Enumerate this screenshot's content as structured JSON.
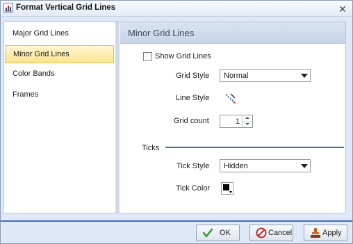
{
  "window": {
    "title": "Format Vertical Grid Lines",
    "close_glyph": "✕"
  },
  "nav": {
    "items": [
      {
        "label": "Major Grid Lines"
      },
      {
        "label": "Minor Grid Lines",
        "selected": true
      },
      {
        "label": "Color Bands"
      },
      {
        "label": "Frames"
      }
    ]
  },
  "panel": {
    "header": "Minor Grid Lines",
    "show_grid_lines": {
      "label": "Show Grid Lines",
      "checked": false
    },
    "grid_style": {
      "label": "Grid Style",
      "value": "Normal"
    },
    "line_style": {
      "label": "Line Style",
      "icon": "line-style-icon"
    },
    "grid_count": {
      "label": "Grid count",
      "value": "1"
    },
    "ticks": {
      "section_label": "Ticks",
      "tick_style": {
        "label": "Tick Style",
        "value": "Hidden"
      },
      "tick_color": {
        "label": "Tick Color",
        "color": "#000000"
      }
    }
  },
  "buttons": {
    "ok": "OK",
    "cancel": "Cancel",
    "apply": "Apply"
  },
  "colors": {
    "accent": "#3f6fb5",
    "selection": "#fce48f",
    "dialog_bg": "#dfe8f6"
  }
}
